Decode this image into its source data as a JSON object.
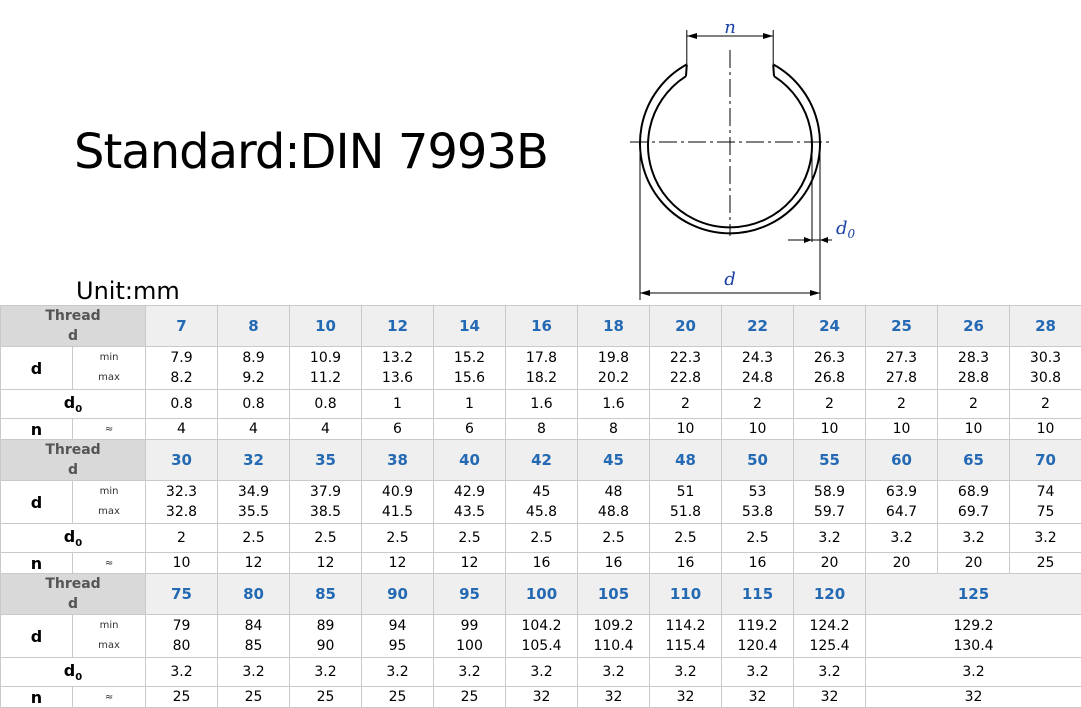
{
  "title": "Standard:DIN 7993B",
  "unit": "Unit:mm",
  "diagram": {
    "label_n": "n",
    "label_d0": "d",
    "label_d0_sub": "0",
    "label_d": "d"
  },
  "table": {
    "thread_label": "Thread",
    "thread_sub": "d",
    "d_label": "d",
    "min_label": "min",
    "max_label": "max",
    "d0_label": "d",
    "d0_sub": "0",
    "n_label": "n",
    "approx_label": "≈",
    "blocks": [
      {
        "thread": [
          "7",
          "8",
          "10",
          "12",
          "14",
          "16",
          "18",
          "20",
          "22",
          "24",
          "25",
          "26",
          "28"
        ],
        "dmin": [
          "7.9",
          "8.9",
          "10.9",
          "13.2",
          "15.2",
          "17.8",
          "19.8",
          "22.3",
          "24.3",
          "26.3",
          "27.3",
          "28.3",
          "30.3"
        ],
        "dmax": [
          "8.2",
          "9.2",
          "11.2",
          "13.6",
          "15.6",
          "18.2",
          "20.2",
          "22.8",
          "24.8",
          "26.8",
          "27.8",
          "28.8",
          "30.8"
        ],
        "d0": [
          "0.8",
          "0.8",
          "0.8",
          "1",
          "1",
          "1.6",
          "1.6",
          "2",
          "2",
          "2",
          "2",
          "2",
          "2"
        ],
        "n": [
          "4",
          "4",
          "4",
          "6",
          "6",
          "8",
          "8",
          "10",
          "10",
          "10",
          "10",
          "10",
          "10"
        ]
      },
      {
        "thread": [
          "30",
          "32",
          "35",
          "38",
          "40",
          "42",
          "45",
          "48",
          "50",
          "55",
          "60",
          "65",
          "70"
        ],
        "dmin": [
          "32.3",
          "34.9",
          "37.9",
          "40.9",
          "42.9",
          "45",
          "48",
          "51",
          "53",
          "58.9",
          "63.9",
          "68.9",
          "74"
        ],
        "dmax": [
          "32.8",
          "35.5",
          "38.5",
          "41.5",
          "43.5",
          "45.8",
          "48.8",
          "51.8",
          "53.8",
          "59.7",
          "64.7",
          "69.7",
          "75"
        ],
        "d0": [
          "2",
          "2.5",
          "2.5",
          "2.5",
          "2.5",
          "2.5",
          "2.5",
          "2.5",
          "2.5",
          "3.2",
          "3.2",
          "3.2",
          "3.2"
        ],
        "n": [
          "10",
          "12",
          "12",
          "12",
          "12",
          "16",
          "16",
          "16",
          "16",
          "20",
          "20",
          "20",
          "25"
        ]
      },
      {
        "thread": [
          "75",
          "80",
          "85",
          "90",
          "95",
          "100",
          "105",
          "110",
          "115",
          "120",
          "125"
        ],
        "dmin": [
          "79",
          "84",
          "89",
          "94",
          "99",
          "104.2",
          "109.2",
          "114.2",
          "119.2",
          "124.2",
          "129.2"
        ],
        "dmax": [
          "80",
          "85",
          "90",
          "95",
          "100",
          "105.4",
          "110.4",
          "115.4",
          "120.4",
          "125.4",
          "130.4"
        ],
        "d0": [
          "3.2",
          "3.2",
          "3.2",
          "3.2",
          "3.2",
          "3.2",
          "3.2",
          "3.2",
          "3.2",
          "3.2",
          "3.2"
        ],
        "n": [
          "25",
          "25",
          "25",
          "25",
          "25",
          "32",
          "32",
          "32",
          "32",
          "32",
          "32"
        ]
      }
    ]
  }
}
